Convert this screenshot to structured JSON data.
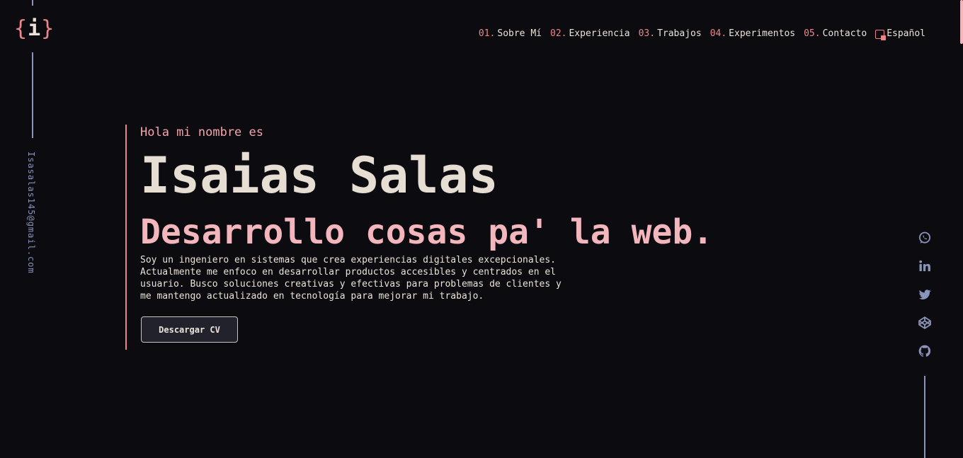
{
  "logo": {
    "open": "{",
    "letter": "i",
    "close": "}"
  },
  "email": "Isasalas145@gmail.com",
  "nav": {
    "items": [
      {
        "num": "01.",
        "label": "Sobre Mí"
      },
      {
        "num": "02.",
        "label": "Experiencia"
      },
      {
        "num": "03.",
        "label": "Trabajos"
      },
      {
        "num": "04.",
        "label": "Experimentos"
      },
      {
        "num": "05.",
        "label": "Contacto"
      }
    ],
    "language": "Español"
  },
  "hero": {
    "greeting": "Hola mi nombre es",
    "name": "Isaias Salas",
    "tagline": "Desarrollo cosas pa' la web.",
    "bio": "Soy un ingeniero en sistemas que crea experiencias digitales excepcionales. Actualmente me enfoco en desarrollar productos accesibles y centrados en el usuario. Busco soluciones creativas y efectivas para problemas de clientes y me mantengo actualizado en tecnología para mejorar mi trabajo.",
    "cv_button": "Descargar CV"
  },
  "social": [
    "whatsapp-icon",
    "linkedin-icon",
    "twitter-icon",
    "codepen-icon",
    "github-icon"
  ],
  "colors": {
    "background": "#0b0b10",
    "accent": "#e8868a",
    "accent_light": "#f3b6bd",
    "text": "#e6ddd3",
    "muted": "#8a93b8"
  }
}
